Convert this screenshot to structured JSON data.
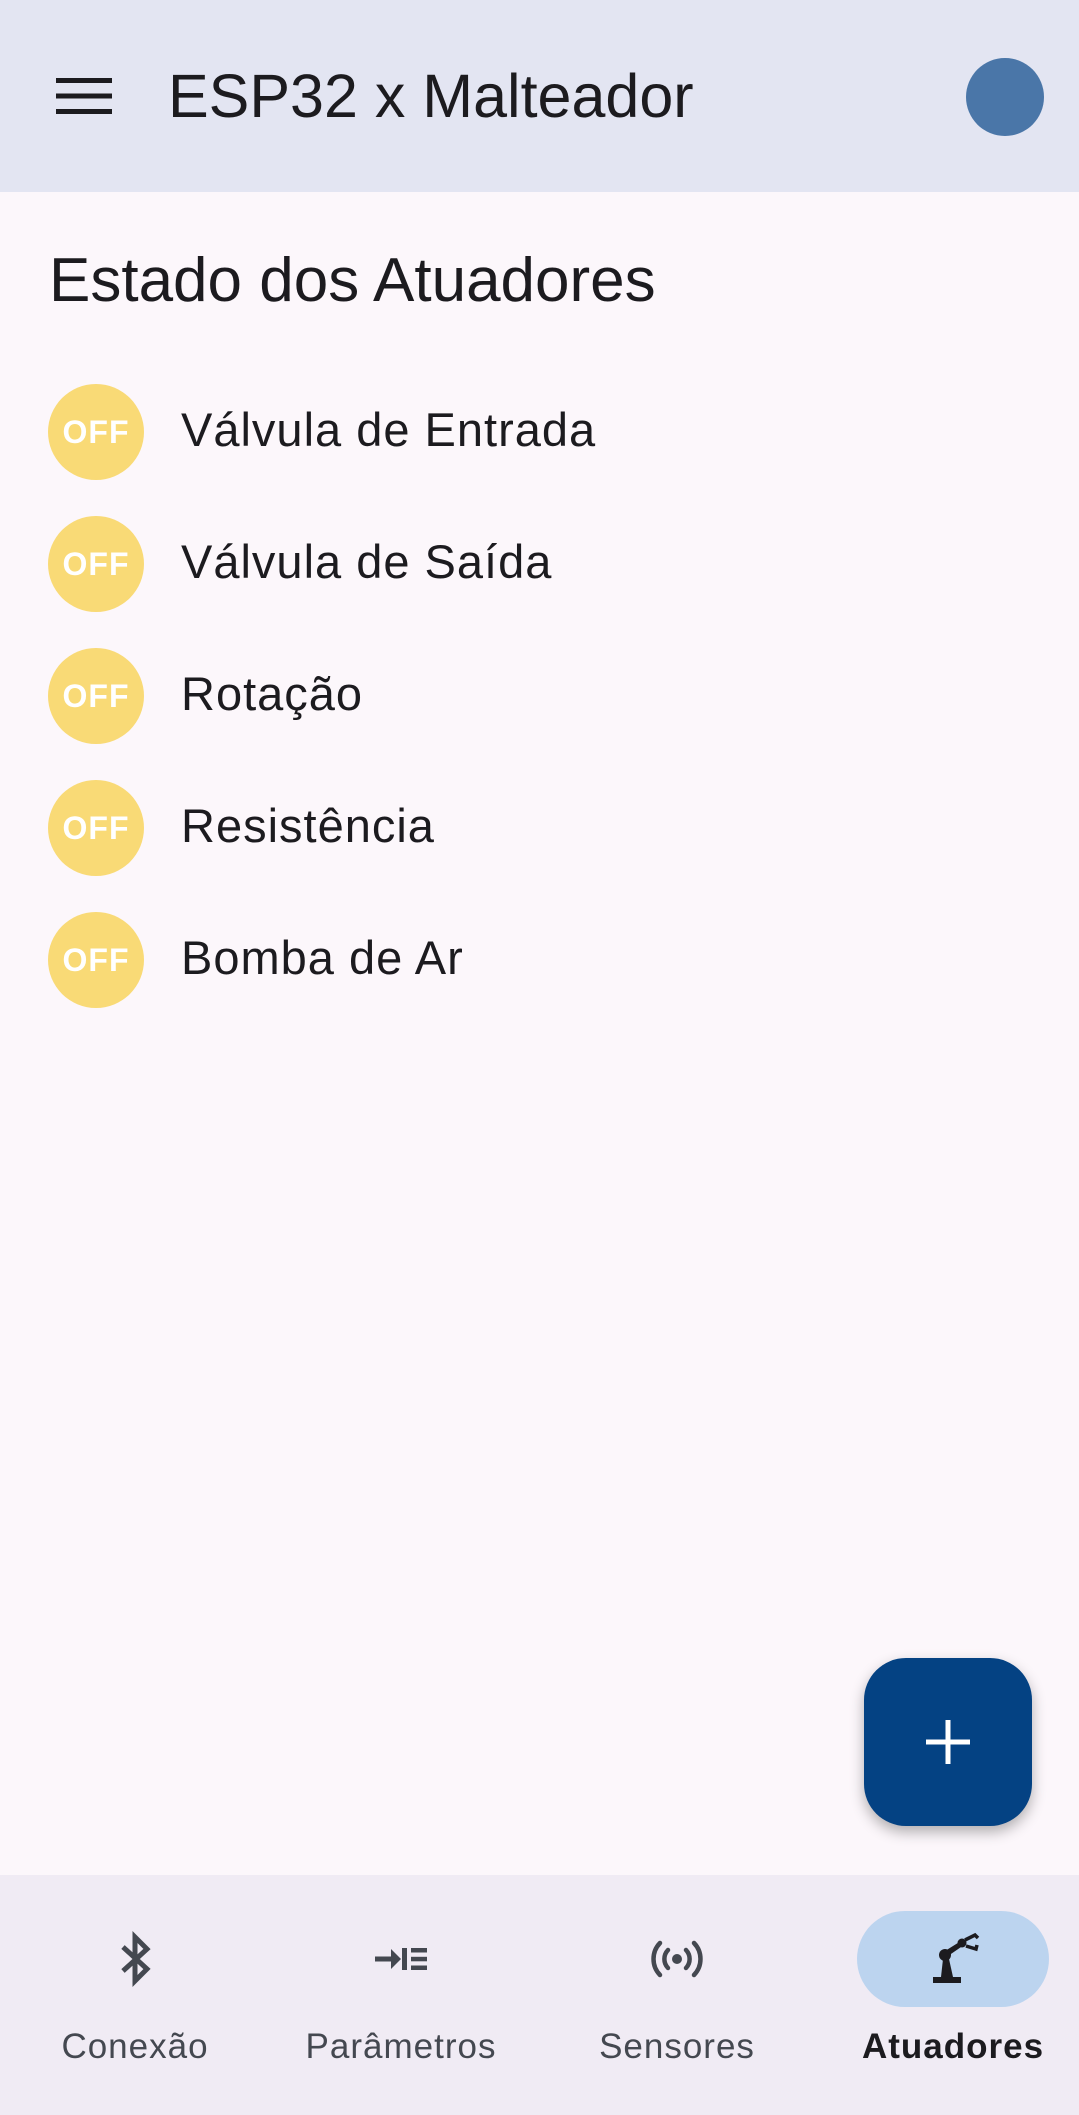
{
  "app_bar": {
    "title": "ESP32 x Malteador",
    "menu_icon": "menu-icon",
    "status_color": "#4a76a8"
  },
  "main": {
    "title": "Estado dos Atuadores",
    "actuators": [
      {
        "label": "Válvula de Entrada",
        "state": "OFF"
      },
      {
        "label": "Válvula de Saída",
        "state": "OFF"
      },
      {
        "label": "Rotação",
        "state": "OFF"
      },
      {
        "label": "Resistência",
        "state": "OFF"
      },
      {
        "label": "Bomba de Ar",
        "state": "OFF"
      }
    ],
    "badge_color": "#f9da76"
  },
  "fab": {
    "icon": "plus-icon",
    "color": "#044283"
  },
  "bottom_nav": {
    "items": [
      {
        "label": "Conexão",
        "icon": "bluetooth-icon"
      },
      {
        "label": "Parâmetros",
        "icon": "input-list-icon"
      },
      {
        "label": "Sensores",
        "icon": "sensors-icon"
      },
      {
        "label": "Atuadores",
        "icon": "robot-arm-icon",
        "active": true
      }
    ],
    "active_color": "#bcd4ef"
  }
}
